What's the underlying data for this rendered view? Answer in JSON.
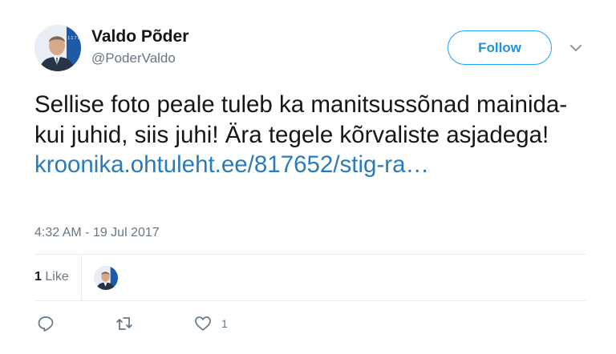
{
  "author": {
    "name": "Valdo Põder",
    "handle": "@PoderValdo",
    "avatar_icon": "profile-photo",
    "avatar_badge_text": "1 1 7 5"
  },
  "follow_button": {
    "label": "Follow"
  },
  "menu": {
    "icon": "chevron-down-icon"
  },
  "tweet": {
    "text": "Sellise foto peale tuleb ka manitsussõnad mainida- kui juhid, siis juhi! Ära tegele kõrvaliste asjadega!",
    "link": "kroonika.ohtuleht.ee/817652/stig-ra…"
  },
  "timestamp": "4:32 AM - 19 Jul 2017",
  "stats": {
    "likes_count": "1",
    "likes_label": "Like"
  },
  "actions": {
    "reply_icon": "reply-icon",
    "retweet_icon": "retweet-icon",
    "like_icon": "heart-icon",
    "like_count": "1"
  },
  "colors": {
    "accent": "#1da1f2",
    "link": "#2b7bb9",
    "muted": "#657786",
    "divider": "#e6ecf0"
  }
}
